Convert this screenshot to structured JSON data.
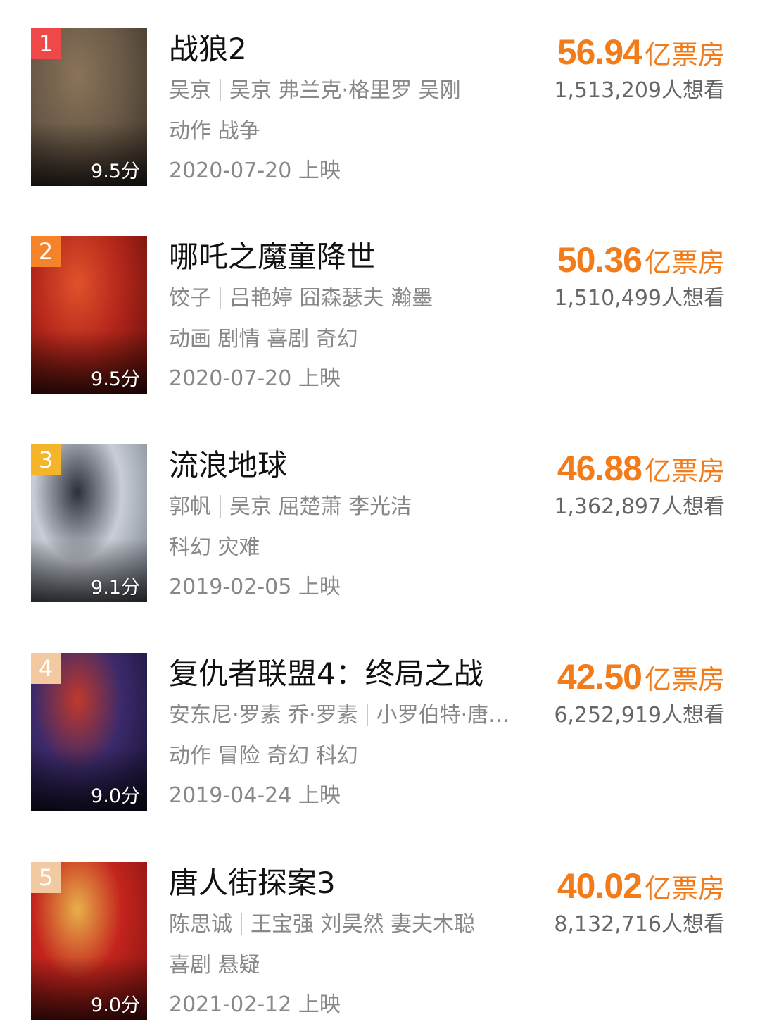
{
  "accent_color": "#f27b1a",
  "movies": [
    {
      "rank": "1",
      "rank_color": "#f04848",
      "score": "9.5分",
      "title": "战狼2",
      "director": "吴京",
      "actors": "吴京 弗兰克·格里罗 吴刚",
      "genres": "动作 战争",
      "release": "2020-07-20 上映",
      "box_value": "56.94",
      "box_unit": "亿票房",
      "want": "1,513,209人想看",
      "poster_colors": [
        "#6b5a48",
        "#3a3128",
        "#8a7358"
      ]
    },
    {
      "rank": "2",
      "rank_color": "#f5832a",
      "score": "9.5分",
      "title": "哪吒之魔童降世",
      "director": "饺子",
      "actors": "吕艳婷 囧森瑟夫 瀚墨",
      "genres": "动画 剧情 喜剧 奇幻",
      "release": "2020-07-20 上映",
      "box_value": "50.36",
      "box_unit": "亿票房",
      "want": "1,510,499人想看",
      "poster_colors": [
        "#b3261b",
        "#5a0f0a",
        "#e0522a"
      ]
    },
    {
      "rank": "3",
      "rank_color": "#f5b52a",
      "score": "9.1分",
      "title": "流浪地球",
      "director": "郭帆",
      "actors": "吴京 屈楚萧 李光洁",
      "genres": "科幻 灾难",
      "release": "2019-02-05 上映",
      "box_value": "46.88",
      "box_unit": "亿票房",
      "want": "1,362,897人想看",
      "poster_colors": [
        "#c9ced6",
        "#6f7784",
        "#2b3038"
      ]
    },
    {
      "rank": "4",
      "rank_color": "#f2c9a0",
      "score": "9.0分",
      "title": "复仇者联盟4：终局之战",
      "director": "安东尼·罗素 乔·罗素",
      "actors": "小罗伯特·唐尼 克里斯·埃文斯",
      "genres": "动作 冒险 奇幻 科幻",
      "release": "2019-04-24 上映",
      "box_value": "42.50",
      "box_unit": "亿票房",
      "want": "6,252,919人想看",
      "poster_colors": [
        "#3b2a6b",
        "#150f2e",
        "#c0392b"
      ]
    },
    {
      "rank": "5",
      "rank_color": "#f2c9a0",
      "score": "9.0分",
      "title": "唐人街探案3",
      "director": "陈思诚",
      "actors": "王宝强 刘昊然 妻夫木聪",
      "genres": "喜剧 悬疑",
      "release": "2021-02-12 上映",
      "box_value": "40.02",
      "box_unit": "亿票房",
      "want": "8,132,716人想看",
      "poster_colors": [
        "#c4241d",
        "#7a1210",
        "#e8b04a"
      ]
    }
  ]
}
